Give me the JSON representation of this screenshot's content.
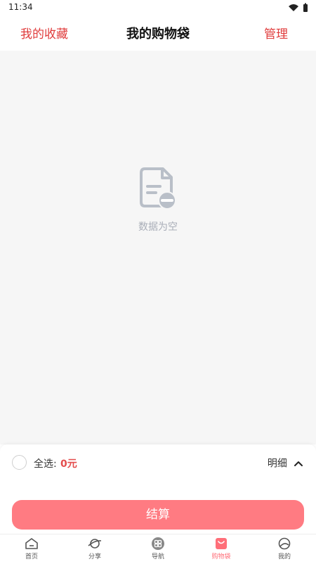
{
  "status_bar": {
    "time": "11:34"
  },
  "header": {
    "favorites_label": "我的收藏",
    "title": "我的购物袋",
    "manage_label": "管理"
  },
  "empty_state": {
    "text": "数据为空"
  },
  "summary": {
    "select_all_label": "全选:",
    "total": "0元",
    "detail_label": "明细"
  },
  "checkout": {
    "label": "结算"
  },
  "tabbar": {
    "items": [
      {
        "label": "首页",
        "icon": "home-icon"
      },
      {
        "label": "分享",
        "icon": "planet-icon"
      },
      {
        "label": "导航",
        "icon": "grid-icon"
      },
      {
        "label": "购物袋",
        "icon": "bag-icon",
        "active": true
      },
      {
        "label": "我的",
        "icon": "profile-icon"
      }
    ]
  },
  "colors": {
    "accent": "#e03c3c",
    "checkout": "#ff7b82",
    "active_tab": "#ff6f79",
    "empty_text": "#a9aeb8"
  }
}
